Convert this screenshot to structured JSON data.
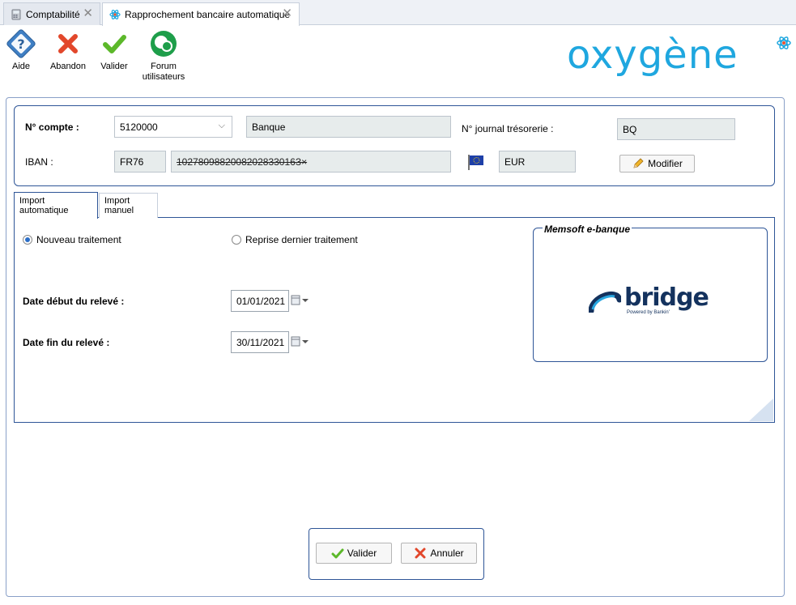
{
  "tabs": [
    {
      "label": "Comptabilité"
    },
    {
      "label": "Rapprochement bancaire automatique"
    }
  ],
  "toolbar": {
    "help": "Aide",
    "abandon": "Abandon",
    "validate": "Valider",
    "forum_line1": "Forum",
    "forum_line2": "utilisateurs"
  },
  "logo": {
    "text": "oxygène",
    "color": "#1fa7df"
  },
  "account": {
    "account_label": "N° compte :",
    "account_value": "5120000",
    "account_name": "Banque",
    "journal_label": "N° journal trésorerie :",
    "journal_value": "BQ",
    "iban_label": "IBAN :",
    "iban_country": "FR76",
    "iban_masked": "1027809882008202833016З×",
    "currency": "EUR",
    "modify_button": "Modifier"
  },
  "import_tabs": [
    {
      "label": "Import automatique"
    },
    {
      "label": "Import manuel"
    }
  ],
  "import": {
    "radio_new": "Nouveau traitement",
    "radio_resume": "Reprise dernier traitement",
    "selected": "Nouveau traitement",
    "date_start_label": "Date début du relevé :",
    "date_start": "01/01/2021",
    "date_end_label": "Date fin du relevé :",
    "date_end": "30/11/2021"
  },
  "ebank": {
    "title": "Memsoft e-banque",
    "brand": "bridge",
    "brand_sub": "Powered by Bankin'"
  },
  "footer": {
    "validate": "Valider",
    "cancel": "Annuler"
  },
  "colors": {
    "accent_border": "#2e5597",
    "field_bg": "#e7ecec",
    "logo": "#1fa7df"
  }
}
